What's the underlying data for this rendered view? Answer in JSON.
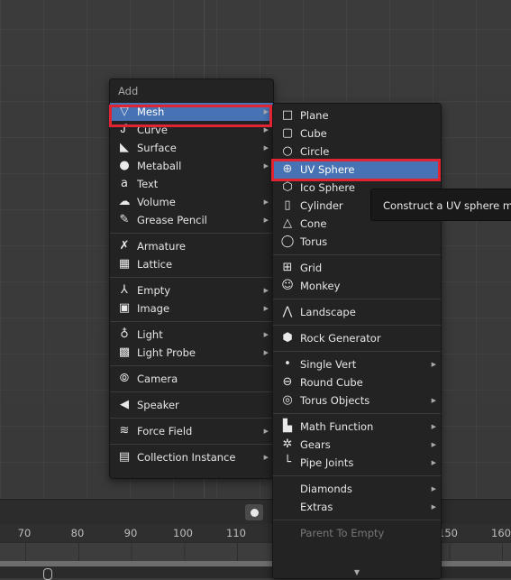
{
  "add_menu": {
    "title": "Add",
    "groups": [
      [
        {
          "label": "Mesh",
          "icon": "mesh-icon",
          "submenu": true,
          "active": true
        },
        {
          "label": "Curve",
          "icon": "curve-icon",
          "submenu": true
        },
        {
          "label": "Surface",
          "icon": "surface-icon",
          "submenu": true
        },
        {
          "label": "Metaball",
          "icon": "metaball-icon",
          "submenu": true
        },
        {
          "label": "Text",
          "icon": "text-icon",
          "submenu": false
        },
        {
          "label": "Volume",
          "icon": "volume-icon",
          "submenu": true
        },
        {
          "label": "Grease Pencil",
          "icon": "grease-pencil-icon",
          "submenu": true
        }
      ],
      [
        {
          "label": "Armature",
          "icon": "armature-icon",
          "submenu": false
        },
        {
          "label": "Lattice",
          "icon": "lattice-icon",
          "submenu": false
        }
      ],
      [
        {
          "label": "Empty",
          "icon": "empty-icon",
          "submenu": true
        },
        {
          "label": "Image",
          "icon": "image-icon",
          "submenu": true
        }
      ],
      [
        {
          "label": "Light",
          "icon": "light-icon",
          "submenu": true
        },
        {
          "label": "Light Probe",
          "icon": "light-probe-icon",
          "submenu": true
        }
      ],
      [
        {
          "label": "Camera",
          "icon": "camera-icon",
          "submenu": false
        }
      ],
      [
        {
          "label": "Speaker",
          "icon": "speaker-icon",
          "submenu": false
        }
      ],
      [
        {
          "label": "Force Field",
          "icon": "force-field-icon",
          "submenu": true
        }
      ],
      [
        {
          "label": "Collection Instance",
          "icon": "collection-instance-icon",
          "submenu": true
        }
      ]
    ]
  },
  "mesh_menu": {
    "groups": [
      [
        {
          "label": "Plane",
          "icon": "plane-icon",
          "submenu": false
        },
        {
          "label": "Cube",
          "icon": "cube-icon",
          "submenu": false
        },
        {
          "label": "Circle",
          "icon": "circle-icon",
          "submenu": false
        },
        {
          "label": "UV Sphere",
          "icon": "uv-sphere-icon",
          "submenu": false,
          "active": true
        },
        {
          "label": "Ico Sphere",
          "icon": "ico-sphere-icon",
          "submenu": false
        },
        {
          "label": "Cylinder",
          "icon": "cylinder-icon",
          "submenu": false
        },
        {
          "label": "Cone",
          "icon": "cone-icon",
          "submenu": false
        },
        {
          "label": "Torus",
          "icon": "torus-icon",
          "submenu": false
        }
      ],
      [
        {
          "label": "Grid",
          "icon": "grid-icon",
          "submenu": false
        },
        {
          "label": "Monkey",
          "icon": "monkey-icon",
          "submenu": false
        }
      ],
      [
        {
          "label": "Landscape",
          "icon": "landscape-icon",
          "submenu": false
        }
      ],
      [
        {
          "label": "Rock Generator",
          "icon": "rock-generator-icon",
          "submenu": false
        }
      ],
      [
        {
          "label": "Single Vert",
          "icon": "single-vert-icon",
          "submenu": true
        },
        {
          "label": "Round Cube",
          "icon": "round-cube-icon",
          "submenu": false
        },
        {
          "label": "Torus Objects",
          "icon": "torus-objects-icon",
          "submenu": true
        }
      ],
      [
        {
          "label": "Math Function",
          "icon": "math-function-icon",
          "submenu": true
        },
        {
          "label": "Gears",
          "icon": "gears-icon",
          "submenu": true
        },
        {
          "label": "Pipe Joints",
          "icon": "pipe-joints-icon",
          "submenu": true
        }
      ],
      [
        {
          "label": "Diamonds",
          "icon": "",
          "submenu": true
        },
        {
          "label": "Extras",
          "icon": "",
          "submenu": true
        }
      ],
      [
        {
          "label": "Parent To Empty",
          "icon": "",
          "submenu": false,
          "disabled": true
        }
      ]
    ]
  },
  "tooltip": {
    "text": "Construct a UV sphere mesh."
  },
  "timeline": {
    "ticks": [
      "70",
      "80",
      "90",
      "100",
      "110",
      "150",
      "160"
    ]
  }
}
